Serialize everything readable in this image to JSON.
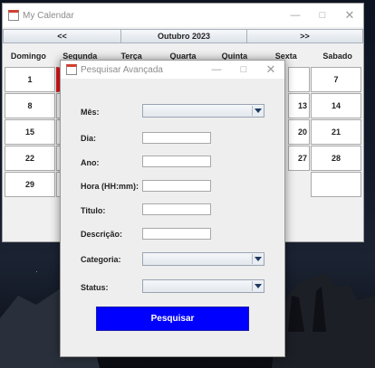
{
  "main_window": {
    "title": "My Calendar",
    "nav": {
      "prev_label": "<<",
      "month_label": "Outubro 2023",
      "next_label": ">>"
    },
    "weekdays": [
      "Domingo",
      "Segunda",
      "Terça",
      "Quarta",
      "Quinta",
      "Sexta",
      "Sabado"
    ],
    "visible_days": {
      "sun": [
        "1",
        "8",
        "15",
        "22",
        "29"
      ],
      "fri": [
        "",
        "13",
        "20",
        "27"
      ],
      "sat": [
        "7",
        "14",
        "21",
        "28",
        ""
      ]
    }
  },
  "dialog": {
    "title": "Pesquisar Avançada",
    "labels": {
      "mes": "Mês:",
      "dia": "Dia:",
      "ano": "Ano:",
      "hora": "Hora (HH:mm):",
      "titulo": "Titulo:",
      "descricao": "Descrição:",
      "categoria": "Categoria:",
      "status": "Status:"
    },
    "values": {
      "mes": "",
      "dia": "",
      "ano": "",
      "hora": "",
      "titulo": "",
      "descricao": "",
      "categoria": "",
      "status": ""
    },
    "search_button": "Pesquisar"
  },
  "colors": {
    "search_button": "#0000ff",
    "today_marker": "#e01818"
  },
  "icons": {
    "window_controls": [
      "minimize-icon",
      "maximize-icon",
      "close-icon"
    ]
  }
}
